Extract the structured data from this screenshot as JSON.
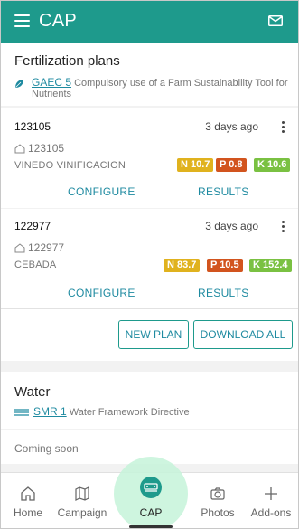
{
  "appbar": {
    "title": "CAP",
    "icons": [
      "menu-icon",
      "mail-icon"
    ]
  },
  "fertilization": {
    "title": "Fertilization plans",
    "requirement": {
      "code": "GAEC 5",
      "text": "Compulsory use of a Farm Sustainability Tool for Nutrients",
      "icon": "leaf-icon"
    },
    "plans": [
      {
        "id": "123105",
        "ago": "3 days ago",
        "parcel": "123105",
        "crop": "VINEDO VINIFICACION",
        "nutrients": {
          "n": "N 10.7",
          "p": "P 0.8",
          "k": "K 10.6"
        },
        "configure": "CONFIGURE",
        "results": "RESULTS"
      },
      {
        "id": "122977",
        "ago": "3 days ago",
        "parcel": "122977",
        "crop": "CEBADA",
        "nutrients": {
          "n": "N 83.7",
          "p": "P 10.5",
          "k": "K 152.4"
        },
        "configure": "CONFIGURE",
        "results": "RESULTS"
      }
    ],
    "new_plan": "NEW PLAN",
    "download_all": "DOWNLOAD ALL"
  },
  "water": {
    "title": "Water",
    "requirement": {
      "code": "SMR 1",
      "text": "Water Framework Directive",
      "icon": "water-icon"
    },
    "coming_soon": "Coming soon"
  },
  "bottomnav": {
    "items": [
      {
        "label": "Home",
        "icon": "home-icon"
      },
      {
        "label": "Campaign",
        "icon": "map-icon"
      },
      {
        "label": "CAP",
        "icon": "cap-icon",
        "active": true
      },
      {
        "label": "Photos",
        "icon": "camera-icon"
      },
      {
        "label": "Add-ons",
        "icon": "plus-icon"
      }
    ]
  },
  "colors": {
    "primary": "#1e9a8c",
    "link": "#1e8aa0",
    "n_badge": "#e0b21e",
    "p_badge": "#d2541e",
    "k_badge": "#7ac142",
    "active_glow": "#c5f3d9"
  }
}
